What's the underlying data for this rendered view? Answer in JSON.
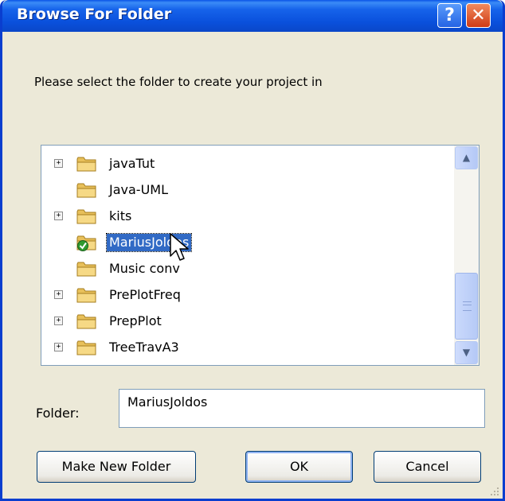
{
  "window": {
    "title": "Browse For Folder",
    "help_label": "?",
    "close_label": "✕"
  },
  "prompt": "Please select the folder to create your project in",
  "tree": {
    "items": [
      {
        "label": "javaTut",
        "expandable": true,
        "selected": false,
        "icon": "folder-icon"
      },
      {
        "label": "Java-UML",
        "expandable": false,
        "selected": false,
        "icon": "folder-icon"
      },
      {
        "label": "kits",
        "expandable": true,
        "selected": false,
        "icon": "folder-icon"
      },
      {
        "label": "MariusJoldos",
        "expandable": false,
        "selected": true,
        "icon": "shared-folder-check-icon"
      },
      {
        "label": "Music conv",
        "expandable": false,
        "selected": false,
        "icon": "folder-icon"
      },
      {
        "label": "PrePlotFreq",
        "expandable": true,
        "selected": false,
        "icon": "folder-icon"
      },
      {
        "label": "PrepPlot",
        "expandable": true,
        "selected": false,
        "icon": "folder-icon"
      },
      {
        "label": "TreeTravA3",
        "expandable": true,
        "selected": false,
        "icon": "folder-icon"
      }
    ],
    "expander_symbol": "+",
    "scroll_up_symbol": "▲",
    "scroll_down_symbol": "▼"
  },
  "folder_field": {
    "label": "Folder:",
    "value": "MariusJoldos"
  },
  "buttons": {
    "make_new_folder": "Make New Folder",
    "ok": "OK",
    "cancel": "Cancel"
  },
  "colors": {
    "title_bar": "#0a54e6",
    "selection": "#316ac5",
    "dialog_bg": "#ece9d8"
  }
}
